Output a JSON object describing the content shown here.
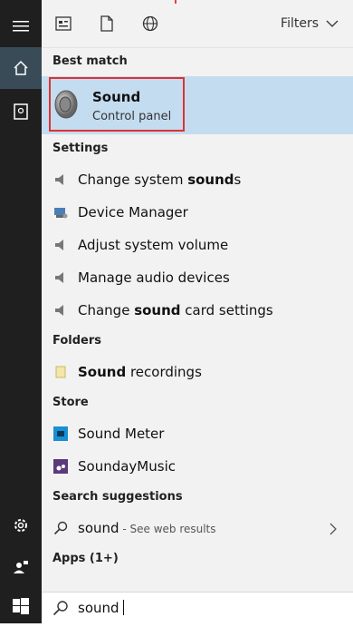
{
  "topbar": {
    "filters_label": "Filters",
    "icons": [
      "apps-icon",
      "document-icon",
      "web-icon",
      "chevron-down-icon"
    ]
  },
  "sections": {
    "best_match": "Best match",
    "settings": "Settings",
    "folders": "Folders",
    "store": "Store",
    "search_suggestions": "Search suggestions",
    "apps": "Apps (1+)"
  },
  "best_match": {
    "title": "Sound",
    "subtitle": "Control panel"
  },
  "settings": [
    {
      "pre": "Change system ",
      "bold": "sound",
      "post": "s"
    },
    {
      "pre": "Device Manager",
      "bold": "",
      "post": ""
    },
    {
      "pre": "Adjust system volume",
      "bold": "",
      "post": ""
    },
    {
      "pre": "Manage audio devices",
      "bold": "",
      "post": ""
    },
    {
      "pre": "Change ",
      "bold": "sound",
      "post": " card settings"
    }
  ],
  "folders": [
    {
      "pre": "",
      "bold": "Sound",
      "post": " recordings"
    }
  ],
  "store": [
    {
      "label": "Sound Meter"
    },
    {
      "label": "SoundayMusic"
    }
  ],
  "suggestion": {
    "query": "sound",
    "sub": " - See web results"
  },
  "search": {
    "value": "sound"
  },
  "colors": {
    "rail_bg": "#1f1f1f",
    "rail_active": "#3a4b58",
    "panel_bg": "#f2f2f2",
    "selection": "#c4dcf0",
    "highlight_border": "#e03030"
  }
}
